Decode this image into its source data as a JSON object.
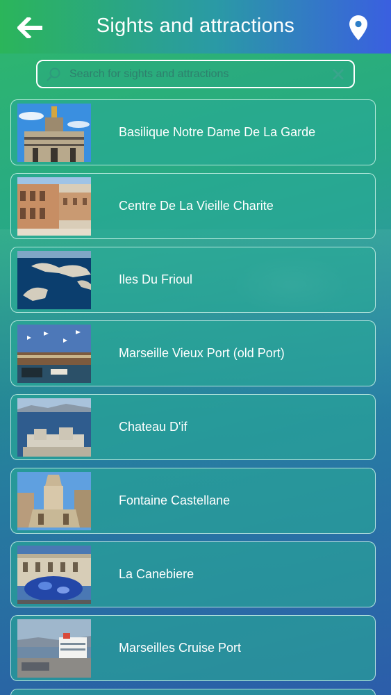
{
  "header": {
    "title": "Sights and attractions",
    "back_icon": "arrow-left-icon",
    "map_icon": "map-pin-icon"
  },
  "search": {
    "placeholder": "Search for sights and attractions",
    "value": ""
  },
  "items": [
    {
      "label": "Basilique Notre Dame De La Garde"
    },
    {
      "label": "Centre De La Vieille Charite"
    },
    {
      "label": "Iles Du Frioul"
    },
    {
      "label": "Marseille Vieux Port (old Port)"
    },
    {
      "label": "Chateau D'if"
    },
    {
      "label": "Fontaine Castellane"
    },
    {
      "label": "La Canebiere"
    },
    {
      "label": "Marseilles Cruise Port"
    }
  ],
  "colors": {
    "header_start": "#2bb55a",
    "header_end": "#3a5fe0",
    "text": "#ffffff"
  }
}
